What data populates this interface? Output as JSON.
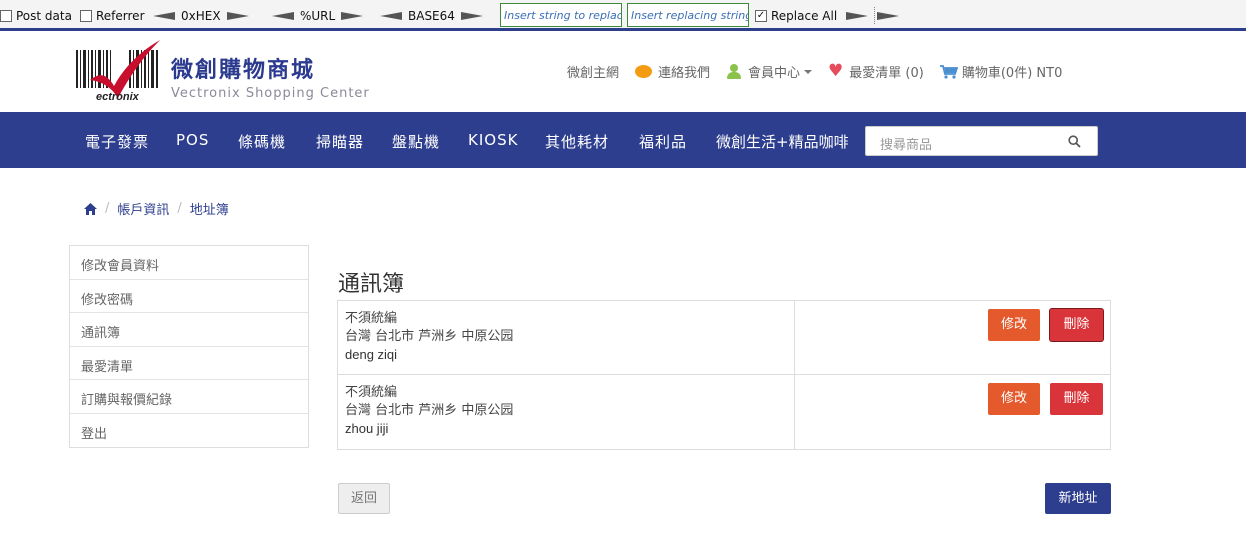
{
  "hackbar": {
    "post_data": "Post data",
    "referrer": "Referrer",
    "hex": "0xHEX",
    "url": "%URL",
    "base64": "BASE64",
    "replace_placeholder": "Insert string to replace",
    "replacing_placeholder": "Insert replacing string",
    "replace_all": "Replace All",
    "replace_all_checked": true
  },
  "header": {
    "brand_zh": "微創購物商城",
    "brand_en": "Vectronix Shopping Center",
    "logo_text": "ectronix",
    "links": {
      "home": "微創主網",
      "contact": "連絡我們",
      "member": "會員中心",
      "wishlist": "最愛清單 (0)",
      "cart": "購物車(0件) NT0"
    }
  },
  "nav": {
    "items": [
      "電子發票",
      "POS",
      "條碼機",
      "掃瞄器",
      "盤點機",
      "KIOSK",
      "其他耗材",
      "福利品",
      "微創生活+精品咖啡"
    ],
    "search_placeholder": "搜尋商品"
  },
  "breadcrumb": {
    "account": "帳戶資訊",
    "current": "地址簿"
  },
  "sidebar": {
    "items": [
      "修改會員資料",
      "修改密碼",
      "通訊簿",
      "最愛清單",
      "訂購與報價紀錄",
      "登出"
    ]
  },
  "main": {
    "title": "通訊簿",
    "addresses": [
      {
        "tax": "不須統編",
        "address": "台灣 台北市 芦洲乡 中原公园",
        "name": "deng ziqi",
        "edit": "修改",
        "delete": "刪除"
      },
      {
        "tax": "不須統編",
        "address": "台灣 台北市 芦洲乡 中原公园",
        "name": "zhou jiji",
        "edit": "修改",
        "delete": "刪除"
      }
    ],
    "back": "返回",
    "new_address": "新地址"
  },
  "colors": {
    "brand": "#2d3e8e",
    "edit": "#e45a2d",
    "delete": "#d9343a"
  }
}
